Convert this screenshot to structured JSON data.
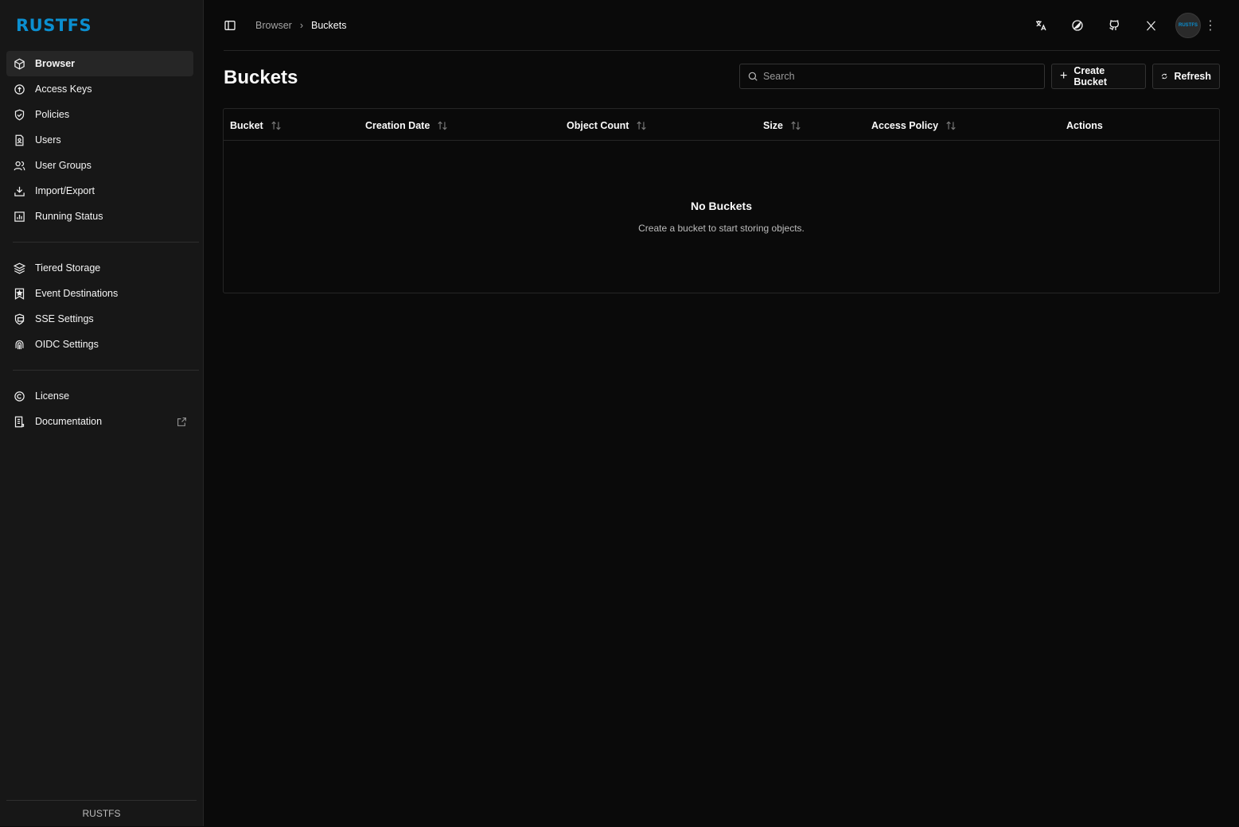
{
  "app": {
    "logo": "RUSTFS",
    "footer": "RUSTFS"
  },
  "sidebar": {
    "items": [
      {
        "label": "Browser",
        "icon": "cube-icon"
      },
      {
        "label": "Access Keys",
        "icon": "key-circle-icon"
      },
      {
        "label": "Policies",
        "icon": "shield-check-icon"
      },
      {
        "label": "Users",
        "icon": "user-file-icon"
      },
      {
        "label": "User Groups",
        "icon": "users-icon"
      },
      {
        "label": "Import/Export",
        "icon": "download-icon"
      },
      {
        "label": "Running Status",
        "icon": "chart-icon"
      },
      {
        "label": "Tiered Storage",
        "icon": "layers-icon"
      },
      {
        "label": "Event Destinations",
        "icon": "bookmark-star-icon"
      },
      {
        "label": "SSE Settings",
        "icon": "shield-card-icon"
      },
      {
        "label": "OIDC Settings",
        "icon": "fingerprint-icon"
      },
      {
        "label": "License",
        "icon": "copyright-icon"
      },
      {
        "label": "Documentation",
        "icon": "document-icon"
      }
    ]
  },
  "breadcrumb": {
    "items": [
      "Browser",
      "Buckets"
    ]
  },
  "header": {
    "avatar": "RUSTFS"
  },
  "page": {
    "title": "Buckets",
    "search_placeholder": "Search",
    "create_label": "Create Bucket",
    "refresh_label": "Refresh"
  },
  "table": {
    "columns": [
      "Bucket",
      "Creation Date",
      "Object Count",
      "Size",
      "Access Policy",
      "Actions"
    ],
    "empty_title": "No Buckets",
    "empty_sub": "Create a bucket to start storing objects."
  }
}
